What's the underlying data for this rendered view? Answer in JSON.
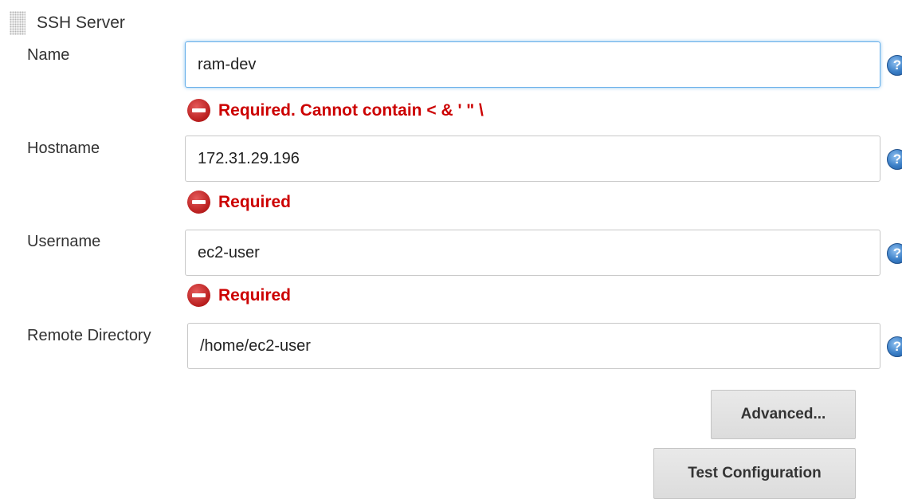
{
  "section": {
    "title": "SSH Server"
  },
  "fields": {
    "name": {
      "label": "Name",
      "value": "ram-dev",
      "error": "Required. Cannot contain < & ' \" \\"
    },
    "hostname": {
      "label": "Hostname",
      "value": "172.31.29.196",
      "error": "Required"
    },
    "username": {
      "label": "Username",
      "value": "ec2-user",
      "error": "Required"
    },
    "remote_directory": {
      "label": "Remote Directory",
      "value": "/home/ec2-user"
    }
  },
  "help": {
    "glyph": "?"
  },
  "buttons": {
    "advanced": "Advanced...",
    "test_configuration": "Test Configuration"
  },
  "colors": {
    "error_text": "#cc0000",
    "focus_border": "#66afe9",
    "help_icon": "#3b7fc7"
  },
  "icons": {
    "drag_handle": "drag-handle-icon",
    "help": "help-icon",
    "error": "error-icon"
  }
}
